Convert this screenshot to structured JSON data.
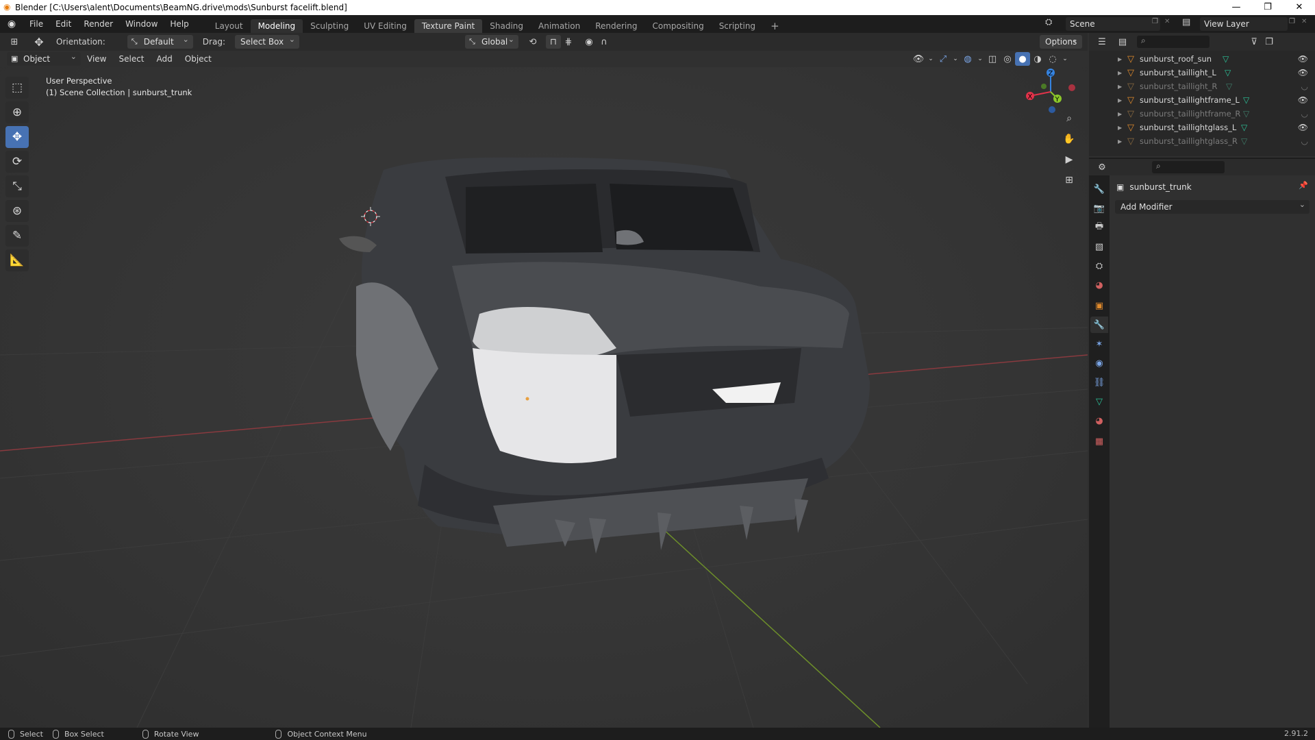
{
  "window": {
    "title": "Blender [C:\\Users\\alent\\Documents\\BeamNG.drive\\mods\\Sunburst facelift.blend]",
    "minimize": "—",
    "maximize": "❐",
    "close": "✕"
  },
  "menu": [
    "File",
    "Edit",
    "Render",
    "Window",
    "Help"
  ],
  "workspaces": [
    {
      "label": "Layout",
      "active": false
    },
    {
      "label": "Modeling",
      "active": true
    },
    {
      "label": "Sculpting",
      "active": false
    },
    {
      "label": "UV Editing",
      "active": false
    },
    {
      "label": "Texture Paint",
      "active": false
    },
    {
      "label": "Shading",
      "active": false
    },
    {
      "label": "Animation",
      "active": false
    },
    {
      "label": "Rendering",
      "active": false
    },
    {
      "label": "Compositing",
      "active": false
    },
    {
      "label": "Scripting",
      "active": false
    }
  ],
  "add_workspace": "+",
  "scene": {
    "label": "Scene",
    "view_layer": "View Layer"
  },
  "tool_header": {
    "orientation_label": "Orientation:",
    "orientation_value": "Default",
    "drag_label": "Drag:",
    "drag_value": "Select Box",
    "transform_orientation": "Global",
    "options": "Options"
  },
  "viewport_header": {
    "mode": "Object Mode",
    "items": [
      "View",
      "Select",
      "Add",
      "Object"
    ]
  },
  "viewport_info": {
    "line1": "User Perspective",
    "line2": "(1) Scene Collection | sunburst_trunk"
  },
  "gizmo": {
    "x": "X",
    "y": "Y",
    "z": "Z"
  },
  "outliner": {
    "rows": [
      {
        "name": "sunburst_roof_sun",
        "dim": false
      },
      {
        "name": "sunburst_taillight_L",
        "dim": false
      },
      {
        "name": "sunburst_taillight_R",
        "dim": true
      },
      {
        "name": "sunburst_taillightframe_L",
        "dim": false
      },
      {
        "name": "sunburst_taillightframe_R",
        "dim": true
      },
      {
        "name": "sunburst_taillightglass_L",
        "dim": false
      },
      {
        "name": "sunburst_taillightglass_R",
        "dim": true
      }
    ]
  },
  "properties": {
    "object_name": "sunburst_trunk",
    "add_modifier": "Add Modifier"
  },
  "statusbar": {
    "select": "Select",
    "box_select": "Box Select",
    "rotate_view": "Rotate View",
    "context_menu": "Object Context Menu",
    "version": "2.91.2"
  },
  "colors": {
    "accent": "#4772b3",
    "x_axis": "#e2334a",
    "y_axis": "#8bc72a",
    "z_axis": "#3583e0",
    "object_orange": "#e08a2c",
    "mesh_green": "#2cc49a"
  }
}
